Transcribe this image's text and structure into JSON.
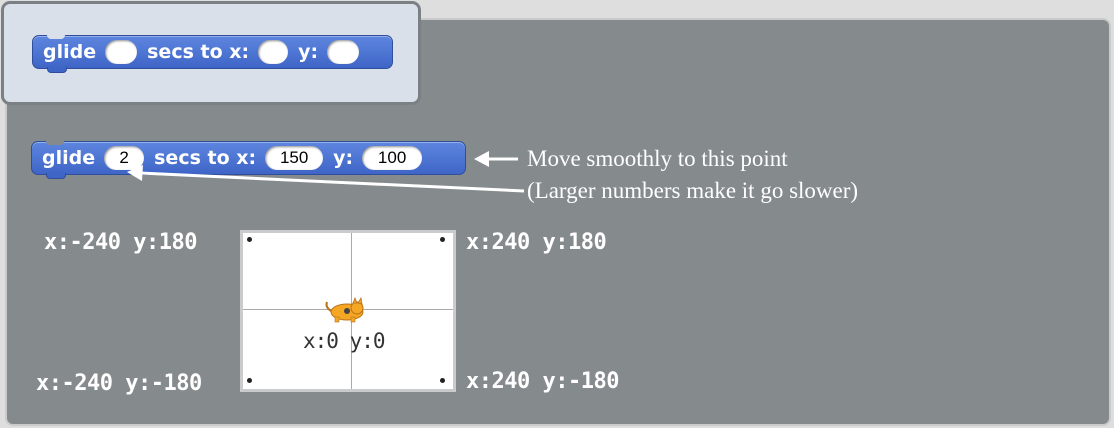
{
  "palette": {
    "block": {
      "glide": "glide",
      "secs_to_x": "secs to x:",
      "y": "y:",
      "secs_value": "",
      "x_value": "",
      "y_value": ""
    }
  },
  "example": {
    "block": {
      "glide": "glide",
      "secs_to_x": "secs to x:",
      "y": "y:",
      "secs_value": "2",
      "x_value": "150",
      "y_value": "100"
    },
    "annotation_line1": "Move smoothly to this point",
    "annotation_line2": "(Larger numbers make it go slower)"
  },
  "stage": {
    "top_left": "x:-240 y:180",
    "top_right": "x:240 y:180",
    "bottom_left": "x:-240 y:-180",
    "bottom_right": "x:240 y:-180",
    "center": "x:0 y:0"
  },
  "colors": {
    "block_blue": "#4a74d6",
    "panel_gray": "#858a8c",
    "palette_bg": "#d9e0e9",
    "sprite_orange": "#f5a623"
  },
  "icons": {
    "sprite": "cat-sprite-icon",
    "arrow": "left-arrow-icon"
  }
}
